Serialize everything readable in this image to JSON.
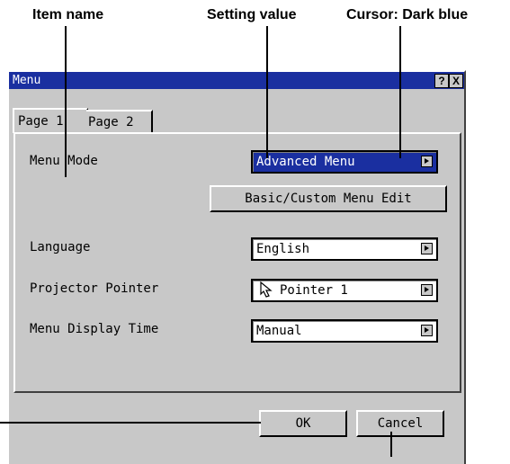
{
  "annotations": {
    "item_name": "Item name",
    "setting_value": "Setting value",
    "cursor": "Cursor: Dark blue"
  },
  "window": {
    "title": "Menu",
    "help_button": "?",
    "close_button": "X"
  },
  "tabs": [
    {
      "label": "Page 1",
      "active": true
    },
    {
      "label": "Page 2",
      "active": false
    }
  ],
  "settings": {
    "menu_mode": {
      "label": "Menu Mode",
      "value": "Advanced Menu"
    },
    "edit_button": "Basic/Custom Menu Edit",
    "language": {
      "label": "Language",
      "value": "English"
    },
    "projector_pointer": {
      "label": "Projector Pointer",
      "value": "Pointer 1",
      "icon": "pointer-arrow-icon"
    },
    "menu_display_time": {
      "label": "Menu Display Time",
      "value": "Manual"
    }
  },
  "buttons": {
    "ok": "OK",
    "cancel": "Cancel"
  },
  "colors": {
    "cursor": "#1a2fa0",
    "titlebar": "#1a2fa0",
    "face": "#c8c8c8"
  }
}
